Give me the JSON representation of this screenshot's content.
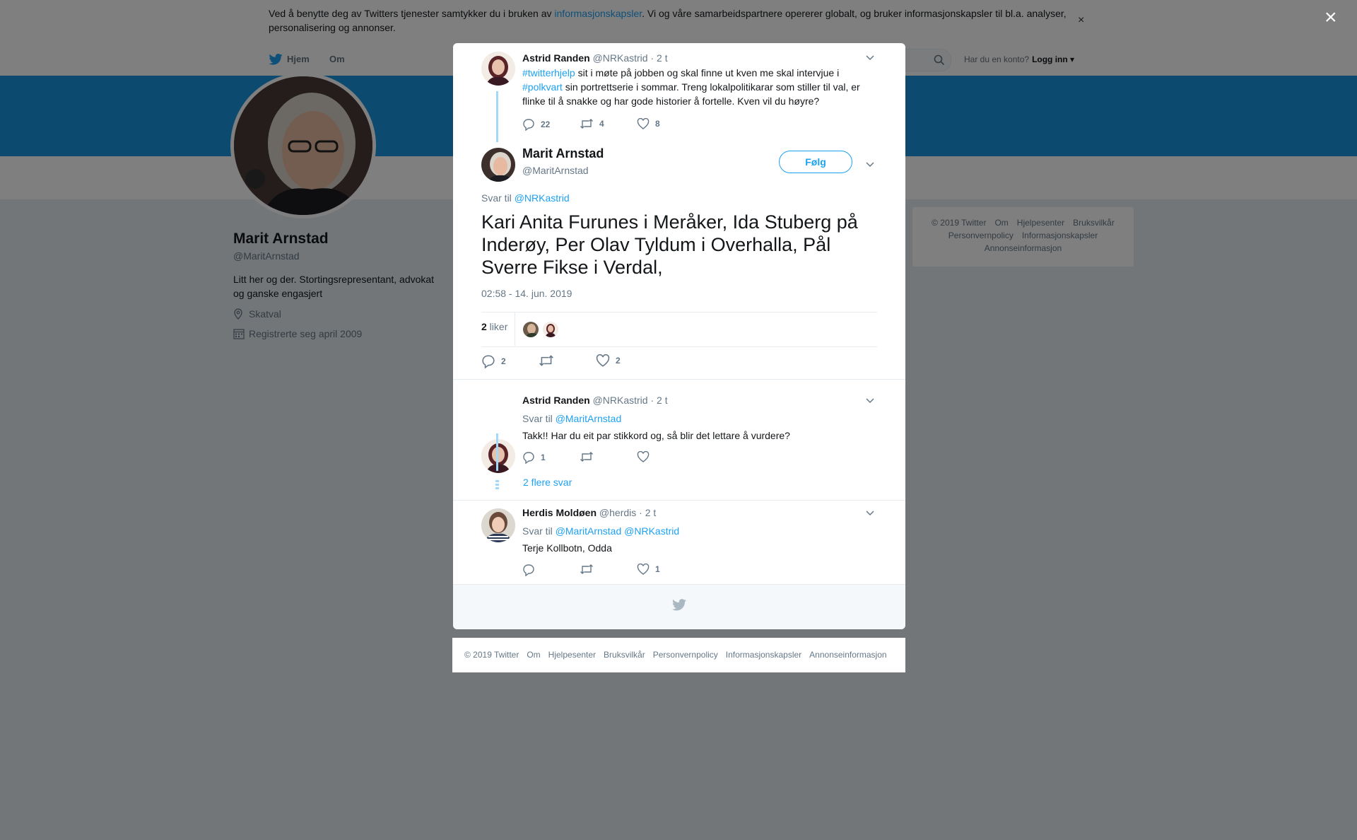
{
  "cookie": {
    "text_before": "Ved å benytte deg av Twitters tjenester samtykker du i bruken av ",
    "link": "informasjonskapsler",
    "text_after": ". Vi og våre samarbeidspartnere opererer globalt, og bruker informasjonskapsler til bl.a. analyser, personalisering og annonser.",
    "close": "×"
  },
  "nav": {
    "home": "Hjem",
    "about": "Om",
    "login_question": "Har du en konto?",
    "login": "Logg inn"
  },
  "profile": {
    "name": "Marit Arnstad",
    "handle": "@MaritArnstad",
    "bio": "Litt her og der. Stortingsrepresentant, advokat og ganske engasjert",
    "location": "Skatval",
    "joined": "Registrerte seg april 2009"
  },
  "side_footer": [
    "© 2019 Twitter",
    "Om",
    "Hjelpesenter",
    "Bruksvilkår",
    "Personvernpolicy",
    "Informasjonskapsler",
    "Annonseinformasjon"
  ],
  "overlay_close": "×",
  "parent_tweet": {
    "name": "Astrid Randen",
    "handle": "@NRKastrid",
    "time": "· 2 t",
    "hashtag1": "#twitterhjelp",
    "text1": " sit i møte på jobben og skal finne ut kven me skal intervjue i ",
    "hashtag2": "#polkvart",
    "text2": " sin portrettserie i sommar. Treng lokalpolitikarar som stiller til val, er flinke til å snakke og har gode historier å fortelle. Kven vil du høyre?",
    "replies": "22",
    "retweets": "4",
    "likes": "8"
  },
  "main_tweet": {
    "name": "Marit Arnstad",
    "handle": "@MaritArnstad",
    "follow": "Følg",
    "reply_to_label": "Svar til ",
    "reply_to": "@NRKastrid",
    "text": "Kari Anita Furunes i Meråker, Ida Stuberg på Inderøy, Per Olav Tyldum i Overhalla, Pål Sverre Fikse i Verdal,",
    "time": "02:58 - 14. jun. 2019",
    "likes_count": "2",
    "likes_label": " liker",
    "replies": "2",
    "retweets": "",
    "likes": "2"
  },
  "reply1": {
    "name": "Astrid Randen",
    "handle": "@NRKastrid",
    "time": "· 2 t",
    "reply_to_label": "Svar til ",
    "reply_to": "@MaritArnstad",
    "text": "Takk!! Har du eit par stikkord og, så blir det lettare å vurdere?",
    "replies": "1",
    "retweets": "",
    "likes": "",
    "more": "2 flere svar"
  },
  "reply2": {
    "name": "Herdis Moldøen",
    "handle": "@herdis",
    "time": "· 2 t",
    "reply_to_label": "Svar til ",
    "reply_to1": "@MaritArnstad",
    "reply_to2": "@NRKastrid",
    "text": "Terje Kollbotn, Odda",
    "replies": "",
    "retweets": "",
    "likes": "1"
  },
  "bottom_footer": [
    "© 2019 Twitter",
    "Om",
    "Hjelpesenter",
    "Bruksvilkår",
    "Personvernpolicy",
    "Informasjonskapsler",
    "Annonseinformasjon"
  ],
  "colors": {
    "brand": "#1da1f2",
    "banner": "#1b95e0",
    "overlay": "rgba(0,0,0,0.5)"
  },
  "icons": [
    "twitter-bird-icon",
    "search-icon",
    "location-icon",
    "calendar-icon",
    "reply-icon",
    "retweet-icon",
    "heart-icon",
    "chevron-down-icon",
    "close-icon"
  ]
}
